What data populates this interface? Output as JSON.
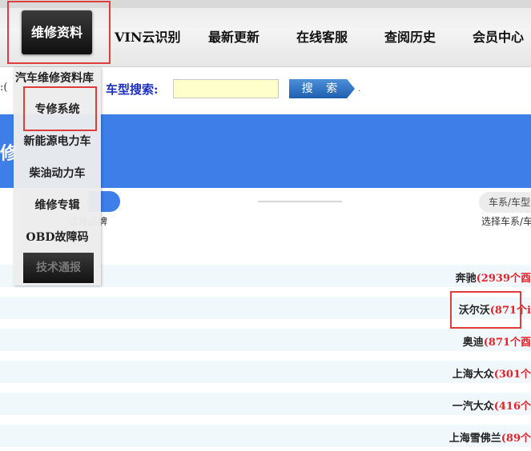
{
  "nav": {
    "active": "维修资料",
    "items": [
      "VIN云识别",
      "最新更新",
      "在线客服",
      "查阅历史",
      "会员中心"
    ]
  },
  "dropdown": {
    "title": "汽车维修资料库",
    "items": [
      "专修系统",
      "新能源电力车",
      "柴油动力车",
      "维修专辑",
      "OBD故障码"
    ],
    "dark_item": "技术通报"
  },
  "search": {
    "left_fragment": ":(",
    "label": "车型搜索:",
    "button": "搜 索",
    "dot": "."
  },
  "banner": {
    "fragment": "修"
  },
  "steps": {
    "left_label": "选择品牌",
    "right_pill": "车系/车型",
    "right_label": "选择车系/车"
  },
  "brands": [
    {
      "name": "奔驰",
      "count": "(2939个酉"
    },
    {
      "name": "沃尔沃",
      "count": "(871个i"
    },
    {
      "name": "奥迪",
      "count": "(871个酉"
    },
    {
      "name": "上海大众",
      "count": "(301个"
    },
    {
      "name": "一汽大众",
      "count": "(416个"
    },
    {
      "name": "上海雪佛兰",
      "count": "(89个"
    }
  ],
  "colors": {
    "accent": "#3d7ee8",
    "highlight": "#e03c3c",
    "count": "#e0242a"
  }
}
